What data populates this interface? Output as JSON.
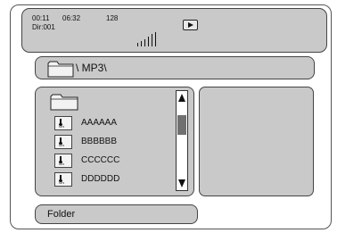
{
  "status": {
    "time_elapsed": "00:11",
    "time_total": "06:32",
    "bitrate": "128",
    "directory": "Dir:001"
  },
  "icons": {
    "play": "play-icon",
    "signal": "signal-bars-icon",
    "folder": "folder-icon",
    "file": "mp3-file-icon"
  },
  "path": {
    "text": "\\ MP3\\"
  },
  "files": [
    {
      "name": "AAAAAA",
      "type": "MP3"
    },
    {
      "name": "BBBBBB",
      "type": "MP3"
    },
    {
      "name": "CCCCCC",
      "type": "MP3"
    },
    {
      "name": "DDDDDD",
      "type": "MP3"
    }
  ],
  "footer": {
    "label": "Folder"
  },
  "colors": {
    "panel": "#c9c9c9",
    "border": "#444444",
    "scroll_thumb": "#707070"
  }
}
